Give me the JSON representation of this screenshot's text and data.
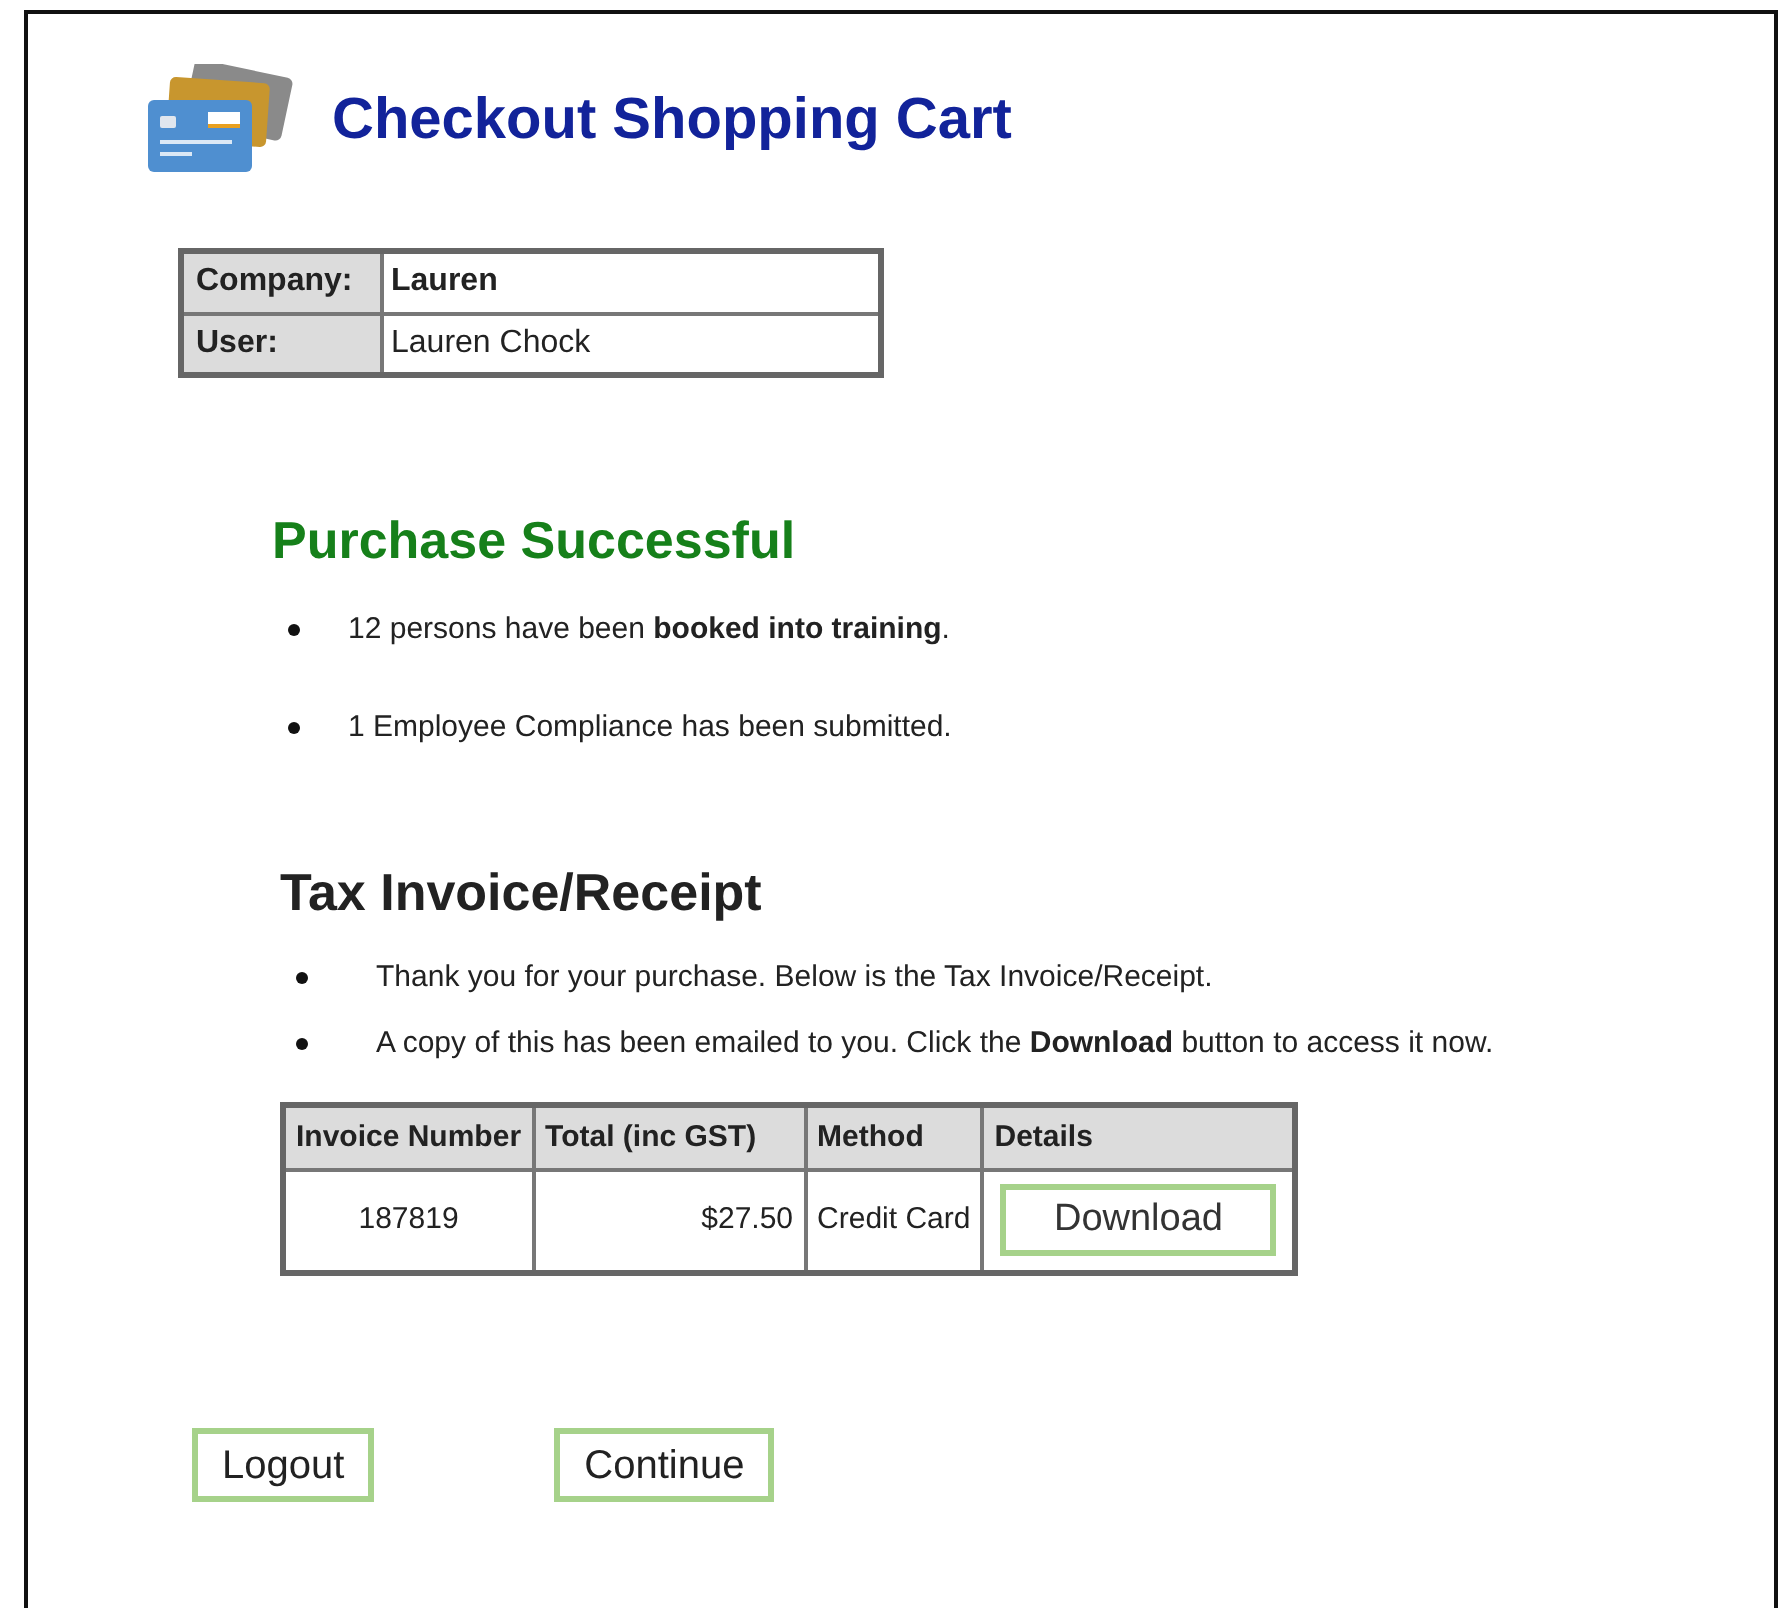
{
  "header": {
    "title": "Checkout Shopping Cart"
  },
  "account": [
    {
      "label": "Company:",
      "value": "Lauren",
      "bold": true
    },
    {
      "label": "User:",
      "value": "Lauren Chock",
      "bold": false
    }
  ],
  "purchase": {
    "heading": "Purchase Successful",
    "items": [
      "12 persons have been **booked into training**.",
      "1 Employee Compliance has been submitted."
    ]
  },
  "invoice": {
    "heading": "Tax Invoice/Receipt",
    "items": [
      "Thank you for your purchase. Below is the Tax Invoice/Receipt.",
      "A copy of this has been emailed to you. Click the **Download** button to access it now."
    ],
    "columns": [
      "Invoice Number",
      "Total (inc GST)",
      "Method",
      "Details"
    ],
    "rows": [
      {
        "number": "187819",
        "total": "$27.50",
        "method": "Credit Card",
        "action": "Download"
      }
    ]
  },
  "buttons": [
    "Logout",
    "Continue"
  ]
}
